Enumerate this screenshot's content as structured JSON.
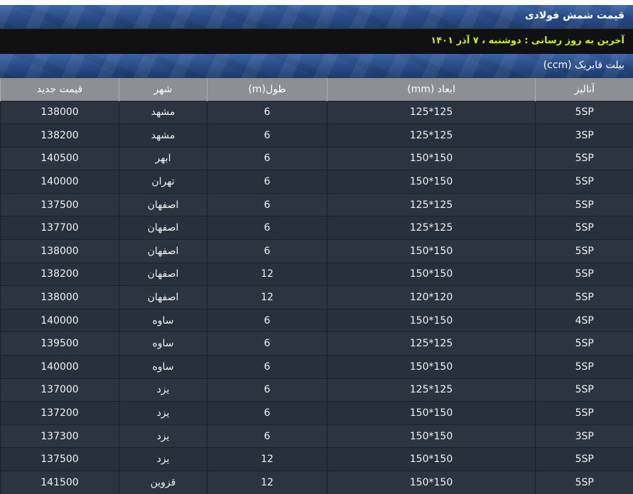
{
  "header": {
    "title": "قیمت شمش فولادی",
    "update": "آخرین به روز رسانی : دوشنبه ، ۷ آذر ۱۴۰۱",
    "section": "بیلت فابریک (ccm)"
  },
  "table": {
    "columns": [
      "آنالیز",
      "ابعاد (mm)",
      "طول(m)",
      "شهر",
      "قیمت جدید"
    ],
    "rows": [
      [
        "5SP",
        "125*125",
        "6",
        "مشهد",
        "138000"
      ],
      [
        "3SP",
        "125*125",
        "6",
        "مشهد",
        "138200"
      ],
      [
        "5SP",
        "150*150",
        "6",
        "ابهر",
        "140500"
      ],
      [
        "5SP",
        "150*150",
        "6",
        "تهران",
        "140000"
      ],
      [
        "5SP",
        "125*125",
        "6",
        "اصفهان",
        "137500"
      ],
      [
        "5SP",
        "125*125",
        "6",
        "اصفهان",
        "137700"
      ],
      [
        "5SP",
        "150*150",
        "6",
        "اصفهان",
        "138000"
      ],
      [
        "5SP",
        "150*150",
        "12",
        "اصفهان",
        "138200"
      ],
      [
        "5SP",
        "120*120",
        "12",
        "اصفهان",
        "138000"
      ],
      [
        "4SP",
        "150*150",
        "6",
        "ساوه",
        "140000"
      ],
      [
        "5SP",
        "125*125",
        "6",
        "ساوه",
        "139500"
      ],
      [
        "5SP",
        "150*150",
        "6",
        "ساوه",
        "140000"
      ],
      [
        "5SP",
        "125*125",
        "6",
        "یزد",
        "137000"
      ],
      [
        "5SP",
        "150*150",
        "6",
        "یزد",
        "137200"
      ],
      [
        "3SP",
        "150*150",
        "6",
        "یزد",
        "137300"
      ],
      [
        "5SP",
        "150*150",
        "12",
        "یزد",
        "137500"
      ],
      [
        "5SP",
        "150*150",
        "12",
        "قزوین",
        "141500"
      ]
    ]
  }
}
